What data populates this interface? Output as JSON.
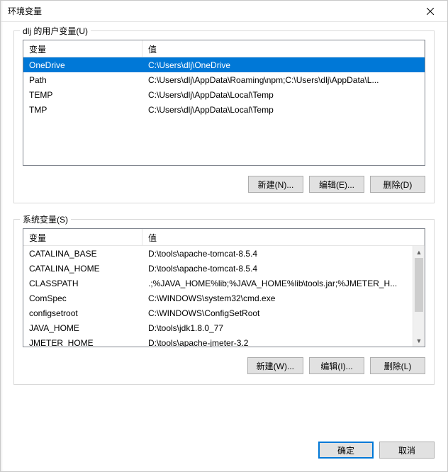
{
  "window": {
    "title": "环境变量"
  },
  "user_group": {
    "legend": "dlj 的用户变量(U)",
    "columns": {
      "var": "变量",
      "val": "值"
    },
    "rows": [
      {
        "var": "OneDrive",
        "val": "C:\\Users\\dlj\\OneDrive",
        "selected": true
      },
      {
        "var": "Path",
        "val": "C:\\Users\\dlj\\AppData\\Roaming\\npm;C:\\Users\\dlj\\AppData\\L..."
      },
      {
        "var": "TEMP",
        "val": "C:\\Users\\dlj\\AppData\\Local\\Temp"
      },
      {
        "var": "TMP",
        "val": "C:\\Users\\dlj\\AppData\\Local\\Temp"
      }
    ],
    "buttons": {
      "new": "新建(N)...",
      "edit": "编辑(E)...",
      "del": "删除(D)"
    }
  },
  "system_group": {
    "legend": "系统变量(S)",
    "columns": {
      "var": "变量",
      "val": "值"
    },
    "rows": [
      {
        "var": "CATALINA_BASE",
        "val": "D:\\tools\\apache-tomcat-8.5.4"
      },
      {
        "var": "CATALINA_HOME",
        "val": "D:\\tools\\apache-tomcat-8.5.4"
      },
      {
        "var": "CLASSPATH",
        "val": ".;%JAVA_HOME%lib;%JAVA_HOME%lib\\tools.jar;%JMETER_H..."
      },
      {
        "var": "ComSpec",
        "val": "C:\\WINDOWS\\system32\\cmd.exe"
      },
      {
        "var": "configsetroot",
        "val": "C:\\WINDOWS\\ConfigSetRoot"
      },
      {
        "var": "JAVA_HOME",
        "val": "D:\\tools\\jdk1.8.0_77"
      },
      {
        "var": "JMETER_HOME",
        "val": "D:\\tools\\apache-jmeter-3.2"
      }
    ],
    "buttons": {
      "new": "新建(W)...",
      "edit": "编辑(I)...",
      "del": "删除(L)"
    }
  },
  "footer": {
    "ok": "确定",
    "cancel": "取消"
  }
}
